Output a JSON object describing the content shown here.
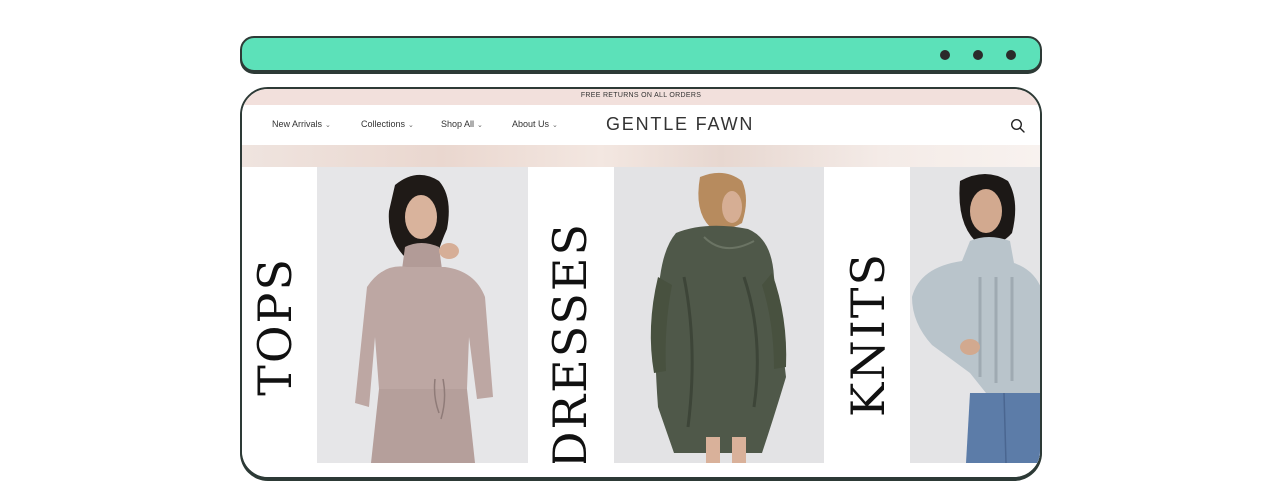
{
  "announcement": "FREE RETURNS ON ALL ORDERS",
  "nav": {
    "items": [
      {
        "label": "New Arrivals"
      },
      {
        "label": "Collections"
      },
      {
        "label": "Shop All"
      },
      {
        "label": "About Us"
      }
    ],
    "chevron": "⌄"
  },
  "brand": {
    "word1": "GENTLE",
    "word2": "FAWN"
  },
  "icons": {
    "search": "search-icon",
    "chevron": "chevron-down-icon",
    "window_dots": "more-dots-icon"
  },
  "categories": [
    {
      "label": "TOPS",
      "image": "model-in-mauve-lounge-set"
    },
    {
      "label": "DRESSES",
      "image": "model-in-olive-velvet-shirt-dress"
    },
    {
      "label": "KNITS",
      "image": "model-in-blue-cable-knit-sweater"
    }
  ],
  "colors": {
    "browser_bar": "#5ce1b9",
    "announcement_bg": "#f2e0dc",
    "text": "#333333"
  }
}
